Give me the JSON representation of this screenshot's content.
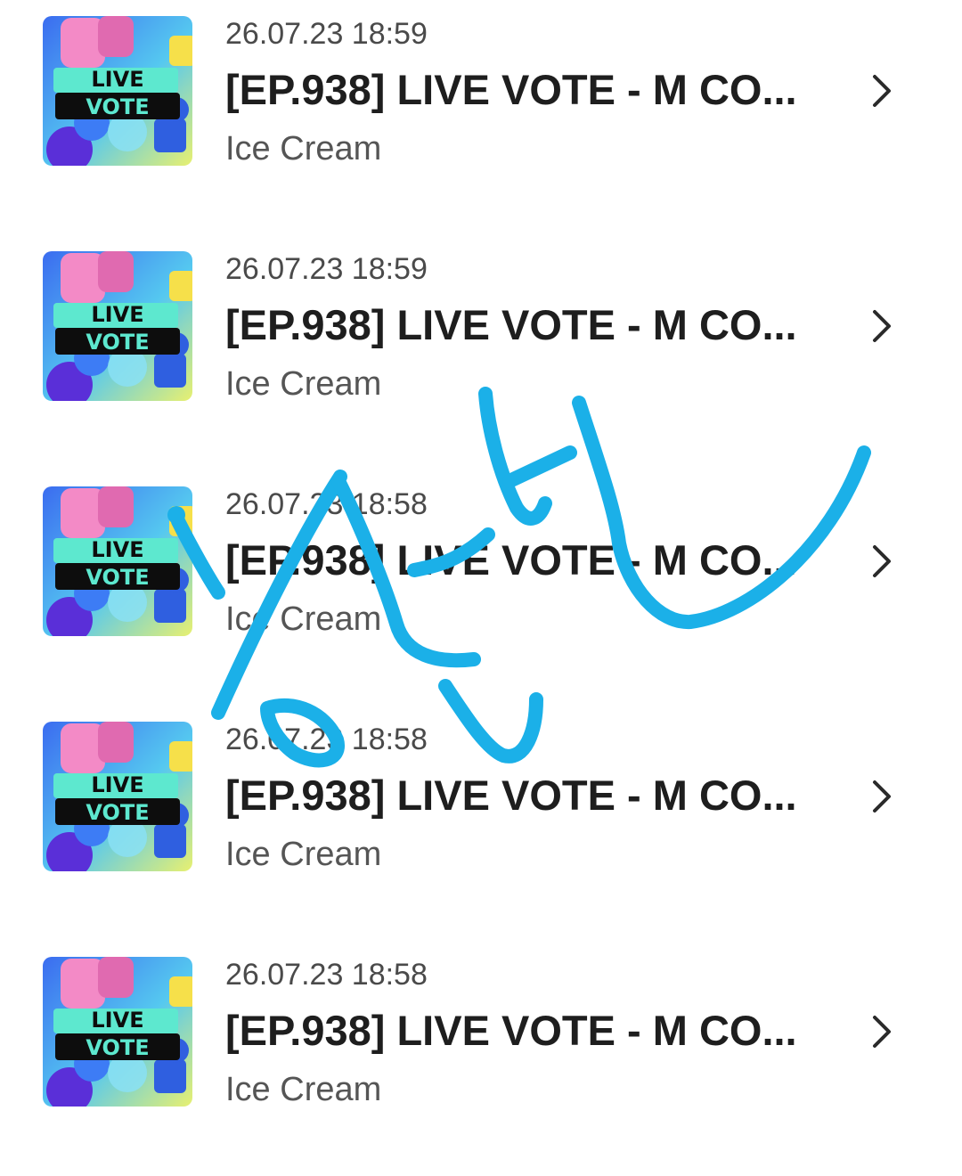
{
  "items": [
    {
      "timestamp": "26.07.23 18:59",
      "title": "[EP.938] LIVE VOTE - M CO...",
      "subtitle": "Ice Cream",
      "thumb_line1": "LIVE",
      "thumb_line2": "VOTE"
    },
    {
      "timestamp": "26.07.23 18:59",
      "title": "[EP.938] LIVE VOTE - M CO...",
      "subtitle": "Ice Cream",
      "thumb_line1": "LIVE",
      "thumb_line2": "VOTE"
    },
    {
      "timestamp": "26.07.23 18:58",
      "title": "[EP.938] LIVE VOTE - M CO...",
      "subtitle": "Ice Cream",
      "thumb_line1": "LIVE",
      "thumb_line2": "VOTE"
    },
    {
      "timestamp": "26.07.23 18:58",
      "title": "[EP.938] LIVE VOTE - M CO...",
      "subtitle": "Ice Cream",
      "thumb_line1": "LIVE",
      "thumb_line2": "VOTE"
    },
    {
      "timestamp": "26.07.23 18:58",
      "title": "[EP.938] LIVE VOTE - M CO...",
      "subtitle": "Ice Cream",
      "thumb_line1": "LIVE",
      "thumb_line2": "VOTE"
    }
  ],
  "icons": {
    "row_arrow": "chevron-right-icon"
  },
  "colors": {
    "scribble": "#1bb0e8",
    "thumb_banner": "#5de8cf",
    "thumb_bg_start": "#3b6cf0",
    "thumb_bg_end": "#e8f070"
  }
}
